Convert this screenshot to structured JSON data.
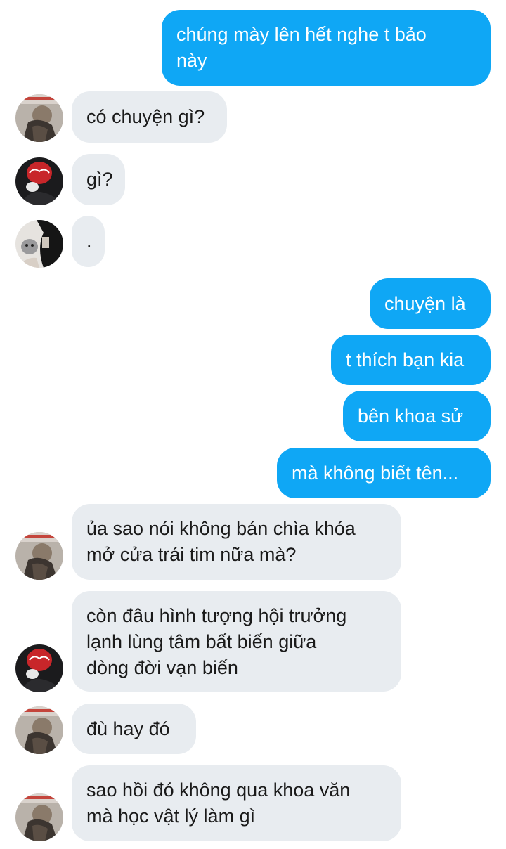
{
  "conversation": {
    "messages": [
      {
        "id": "m1",
        "side": "outgoing",
        "lines": [
          "chúng mày lên hết nghe t bảo",
          "này"
        ]
      },
      {
        "id": "m2",
        "side": "incoming",
        "avatar": "avatar-user-a",
        "lines": [
          "có chuyện gì?"
        ]
      },
      {
        "id": "m3",
        "side": "incoming",
        "avatar": "avatar-user-b",
        "lines": [
          "gì?"
        ]
      },
      {
        "id": "m4",
        "side": "incoming",
        "avatar": "avatar-user-c",
        "lines": [
          "."
        ]
      },
      {
        "id": "m5",
        "side": "outgoing",
        "lines": [
          "chuyện là"
        ]
      },
      {
        "id": "m6",
        "side": "outgoing",
        "lines": [
          "t thích bạn kia"
        ]
      },
      {
        "id": "m7",
        "side": "outgoing",
        "lines": [
          "bên khoa sử"
        ]
      },
      {
        "id": "m8",
        "side": "outgoing",
        "lines": [
          "mà không biết tên..."
        ]
      },
      {
        "id": "m9",
        "side": "incoming",
        "avatar": "avatar-user-a",
        "lines": [
          "ủa sao nói không bán chìa khóa",
          "mở cửa trái tim nữa mà?"
        ]
      },
      {
        "id": "m10",
        "side": "incoming",
        "avatar": "avatar-user-b",
        "lines": [
          "còn đâu hình tượng hội trưởng",
          "lạnh lùng tâm bất biến giữa",
          "dòng đời vạn biến"
        ]
      },
      {
        "id": "m11",
        "side": "incoming",
        "avatar": "avatar-user-a",
        "lines": [
          "đù hay đó"
        ]
      },
      {
        "id": "m12",
        "side": "incoming",
        "avatar": "avatar-user-a",
        "lines": [
          "sao hồi đó không qua khoa văn",
          "mà học vật lý làm gì"
        ]
      }
    ]
  },
  "colors": {
    "outgoing_bubble": "#0fa7f5",
    "incoming_bubble": "#e8ecf0",
    "outgoing_text": "#ffffff",
    "incoming_text": "#1a1a1a"
  }
}
